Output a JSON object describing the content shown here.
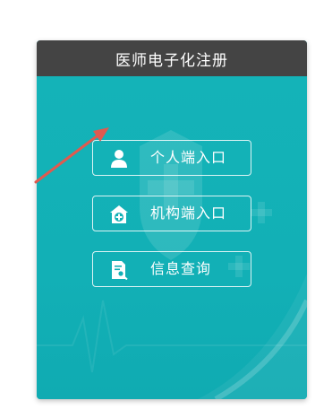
{
  "header": {
    "title": "医师电子化注册"
  },
  "entries": [
    {
      "label": "个人端入口",
      "icon": "person-icon"
    },
    {
      "label": "机构端入口",
      "icon": "hospital-icon"
    },
    {
      "label": "信息查询",
      "icon": "document-search-icon"
    }
  ],
  "colors": {
    "header_bg": "#444444",
    "card_bg": "#12b0b6",
    "arrow": "#e05a4f"
  }
}
